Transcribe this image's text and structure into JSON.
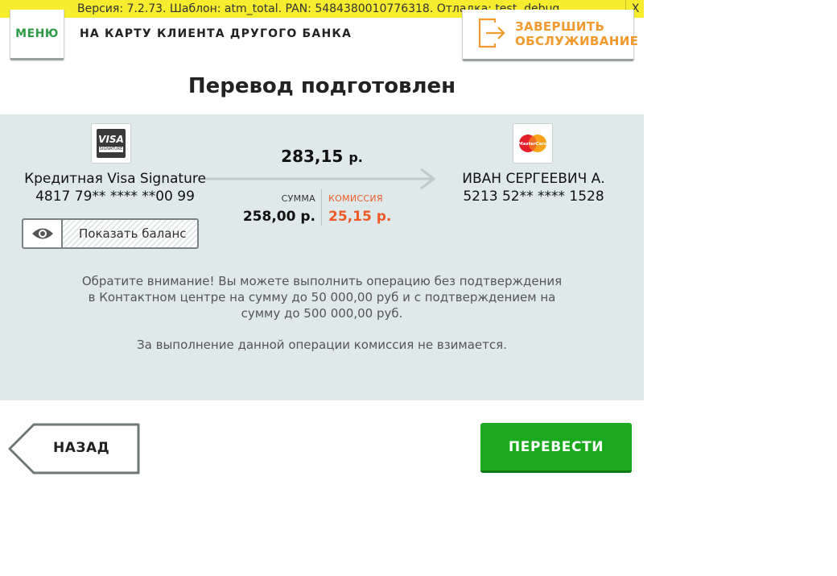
{
  "debug": {
    "text": "Версия: 7.2.73. Шаблон: atm_total. PAN: 5484380010776318. Отладка: test, debug.",
    "close": "X"
  },
  "header": {
    "menu_label": "МЕНЮ",
    "subtitle": "НА КАРТУ КЛИЕНТА ДРУГОГО БАНКА",
    "finish_label": "ЗАВЕРШИТЬ\nОБСЛУЖИВАНИЕ"
  },
  "title": "Перевод подготовлен",
  "transfer": {
    "from": {
      "name": "Кредитная Visa Signature",
      "number": "4817 79** **** **00 99",
      "logo": "visa-signature-logo",
      "logo_text": "VISA",
      "logo_subtext": "SIGNATURE"
    },
    "to": {
      "name": "ИВАН СЕРГЕЕВИЧ А.",
      "number": "5213 52** **** 1528",
      "logo": "mastercard-logo",
      "logo_text": "MasterCard"
    },
    "total": "283,15",
    "currency": "р.",
    "sum_label": "СУММА",
    "sum_value": "258,00 р.",
    "fee_label": "КОМИССИЯ",
    "fee_value": "25,15 р."
  },
  "balance_button": {
    "label": "Показать баланс",
    "icon": "eye-icon"
  },
  "notice": {
    "main": "Обратите внимание! Вы можете выполнить операцию без подтверждения в Контактном центре на сумму до 50 000,00 руб и с подтверждением на сумму до 500 000,00 руб.",
    "fee": "За выполнение данной операции комиссия не взимается."
  },
  "buttons": {
    "back": "НАЗАД",
    "send": "ПЕРЕВЕСТИ"
  },
  "colors": {
    "green": "#1ba91e",
    "orange": "#f29a2e",
    "fee": "#f05a28",
    "panel": "#dfe9e9",
    "debug": "#f5ed2e"
  }
}
